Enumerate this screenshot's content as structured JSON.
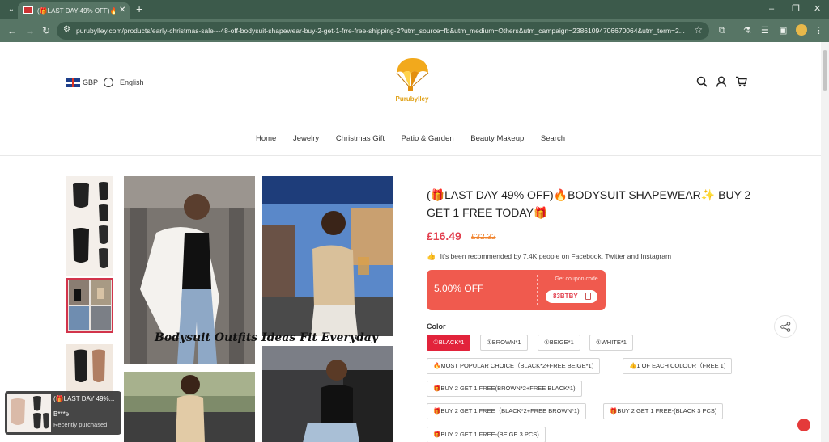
{
  "browser": {
    "tab_title": "(🎁LAST DAY 49% OFF)🔥BODYSUIT SHAPEWEAR",
    "url": "purubylley.com/products/early-christmas-sale---48-off-bodysuit-shapewear-buy-2-get-1-frre-free-shipping-2?utm_source=fb&utm_medium=Others&utm_campaign=23861094706670064&utm_term=2...",
    "new_tab_label": "+",
    "window_controls": {
      "minimize": "–",
      "restore": "❐",
      "close": "✕"
    }
  },
  "header": {
    "currency": "GBP",
    "language": "English",
    "logo_text": "Purubylley"
  },
  "nav": {
    "items": [
      "Home",
      "Jewelry",
      "Christmas Gift",
      "Patio & Garden",
      "Beauty Makeup",
      "Search"
    ]
  },
  "gallery": {
    "banner_text": "Bodysuit Outfits Ideas Fit Everyday"
  },
  "product": {
    "title": "(🎁LAST DAY 49% OFF)🔥BODYSUIT SHAPEWEAR✨ BUY 2 GET 1 FREE TODAY🎁",
    "price": "£16.49",
    "old_price": "£32.32",
    "recommend_text": "It's been recommended by 7.4K people on Facebook, Twitter and Instagram",
    "coupon": {
      "discount": "5.00% OFF",
      "label": "Get coupon code",
      "code": "83BTBY"
    },
    "color_label": "Color",
    "options": [
      "①BLACK*1",
      "①BROWN*1",
      "①BEIGE*1",
      "①WHITE*1",
      "🔥MOST POPULAR CHOICE（BLACK*2+FREE BEIGE*1)",
      "👍1 OF EACH COLOUR（FREE 1)",
      "🎁BUY 2 GET 1 FREE(BROWN*2+FREE BLACK*1)",
      "🎁BUY 2 GET 1 FREE（BLACK*2+FREE BROWN*1)",
      "🎁BUY 2 GET 1 FREE-(BLACK 3 PCS)",
      "🎁BUY 2 GET 1 FREE-(BEIGE 3 PCS)"
    ],
    "selected_option_index": 0
  },
  "toast": {
    "title": "(🎁LAST DAY 49%...",
    "name": "B***e",
    "subtitle": "Recently purchased"
  },
  "colors": {
    "accent": "#e2233b",
    "price": "#e2404f",
    "old_price": "#f0832d",
    "chrome": "#3c5a4b"
  }
}
